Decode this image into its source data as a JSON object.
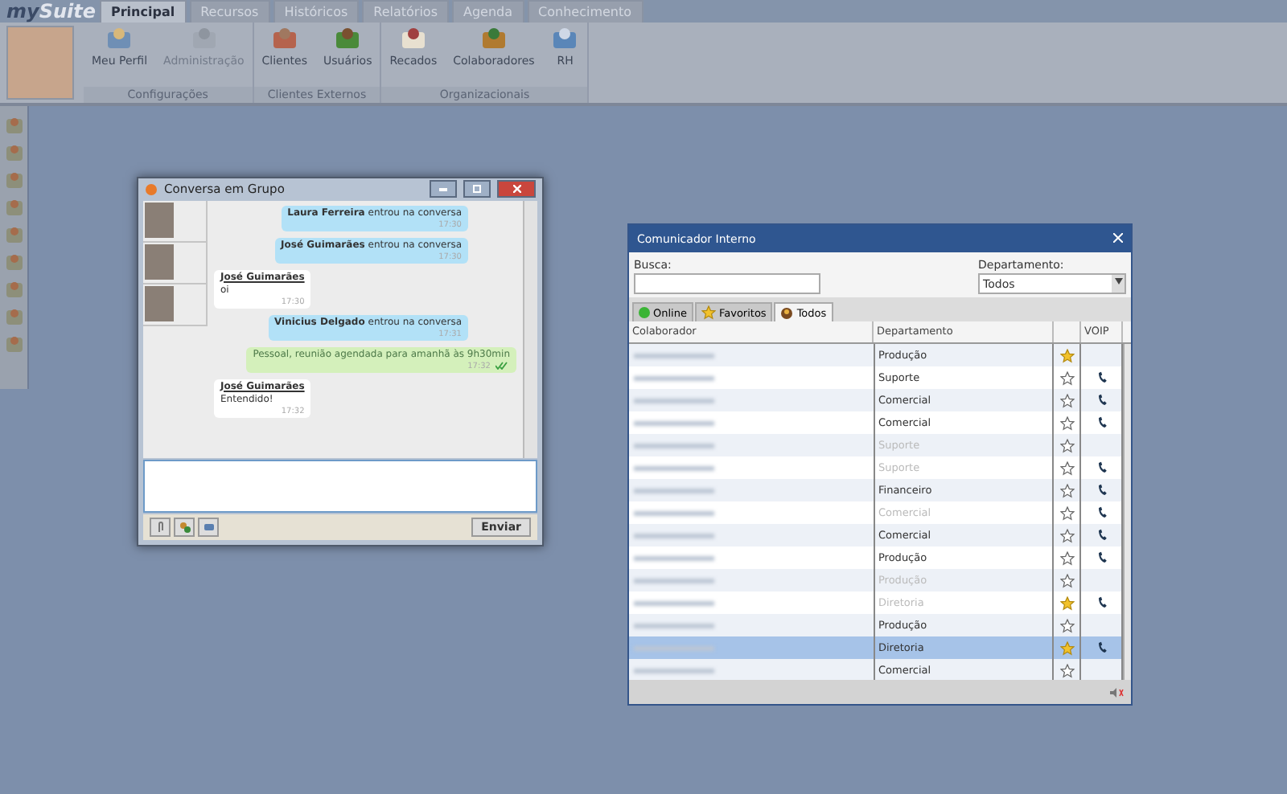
{
  "app": {
    "logo_prefix": "my",
    "logo_suffix": "Suite"
  },
  "tabs": [
    {
      "label": "Principal",
      "selected": true
    },
    {
      "label": "Recursos",
      "selected": false
    },
    {
      "label": "Históricos",
      "selected": false
    },
    {
      "label": "Relatórios",
      "selected": false
    },
    {
      "label": "Agenda",
      "selected": false
    },
    {
      "label": "Conhecimento",
      "selected": false
    }
  ],
  "ribbon_groups": [
    {
      "label": "Configurações",
      "items": [
        {
          "label": "Meu Perfil",
          "disabled": false
        },
        {
          "label": "Administração",
          "disabled": true
        }
      ]
    },
    {
      "label": "Clientes Externos",
      "items": [
        {
          "label": "Clientes",
          "disabled": false
        },
        {
          "label": "Usuários",
          "disabled": false
        }
      ]
    },
    {
      "label": "Organizacionais",
      "items": [
        {
          "label": "Recados",
          "disabled": false
        },
        {
          "label": "Colaboradores",
          "disabled": false
        },
        {
          "label": "RH",
          "disabled": false
        }
      ]
    }
  ],
  "chat": {
    "title": "Conversa em Grupo",
    "messages": [
      {
        "kind": "system",
        "name": "Laura Ferreira",
        "text": "entrou na conversa",
        "time": "17:30"
      },
      {
        "kind": "system",
        "name": "José Guimarães",
        "text": "entrou na conversa",
        "time": "17:30"
      },
      {
        "kind": "incoming",
        "name": "José Guimarães",
        "text": "oi",
        "time": "17:30"
      },
      {
        "kind": "system",
        "name": "Vinicius Delgado",
        "text": "entrou na conversa",
        "time": "17:31"
      },
      {
        "kind": "outgoing",
        "text": "Pessoal, reunião agendada para amanhã às 9h30min",
        "time": "17:32",
        "read": true
      },
      {
        "kind": "incoming",
        "name": "José Guimarães",
        "text": "Entendido!",
        "time": "17:32"
      }
    ],
    "send_label": "Enviar"
  },
  "communicator": {
    "title": "Comunicador Interno",
    "search_label": "Busca:",
    "department_label": "Departamento:",
    "department_value": "Todos",
    "filters": [
      {
        "label": "Online",
        "selected": false
      },
      {
        "label": "Favoritos",
        "selected": false
      },
      {
        "label": "Todos",
        "selected": true
      }
    ],
    "columns": [
      "Colaborador",
      "Departamento",
      "VOIP"
    ],
    "rows": [
      {
        "department": "Produção",
        "online": true,
        "favorite": true,
        "voip": false,
        "selected": false
      },
      {
        "department": "Suporte",
        "online": true,
        "favorite": false,
        "voip": true,
        "selected": false
      },
      {
        "department": "Comercial",
        "online": true,
        "favorite": false,
        "voip": true,
        "selected": false
      },
      {
        "department": "Comercial",
        "online": true,
        "favorite": false,
        "voip": true,
        "selected": false
      },
      {
        "department": "Suporte",
        "online": false,
        "favorite": false,
        "voip": false,
        "selected": false
      },
      {
        "department": "Suporte",
        "online": false,
        "favorite": false,
        "voip": true,
        "selected": false
      },
      {
        "department": "Financeiro",
        "online": true,
        "favorite": false,
        "voip": true,
        "selected": false
      },
      {
        "department": "Comercial",
        "online": false,
        "favorite": false,
        "voip": true,
        "selected": false
      },
      {
        "department": "Comercial",
        "online": true,
        "favorite": false,
        "voip": true,
        "selected": false
      },
      {
        "department": "Produção",
        "online": true,
        "favorite": false,
        "voip": true,
        "selected": false
      },
      {
        "department": "Produção",
        "online": false,
        "favorite": false,
        "voip": false,
        "selected": false
      },
      {
        "department": "Diretoria",
        "online": false,
        "favorite": true,
        "voip": true,
        "selected": false
      },
      {
        "department": "Produção",
        "online": true,
        "favorite": false,
        "voip": false,
        "selected": false
      },
      {
        "department": "Diretoria",
        "online": true,
        "favorite": true,
        "voip": true,
        "selected": true
      },
      {
        "department": "Comercial",
        "online": true,
        "favorite": false,
        "voip": false,
        "selected": false
      }
    ]
  }
}
